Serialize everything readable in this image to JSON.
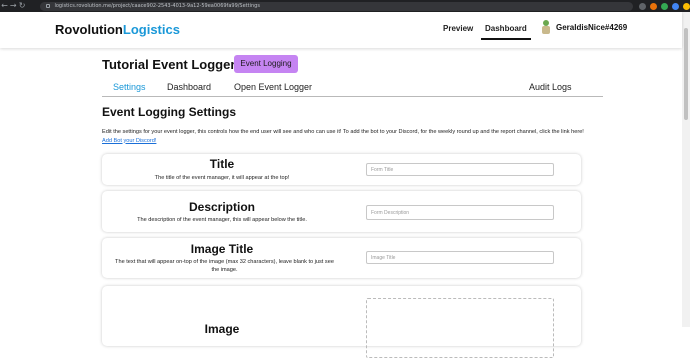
{
  "browser": {
    "url": "logistics.rovolution.me/project/caace902-2543-4013-9a12-59ea0069fa99/Settings"
  },
  "header": {
    "brand_main": "Rovolution",
    "brand_accent": "Logistics",
    "nav": {
      "preview": "Preview",
      "dashboard": "Dashboard"
    },
    "username": "GeraldisNice#4269"
  },
  "page": {
    "title": "Tutorial Event Logger",
    "tag": "Event Logging"
  },
  "tabs": {
    "settings": "Settings",
    "dashboard": "Dashboard",
    "open": "Open Event Logger",
    "audit": "Audit Logs"
  },
  "section": {
    "title": "Event Logging Settings",
    "intro": "Edit the settings for your event logger, this controls how the end user will see and who can use it! To add the bot to your Discord, for the weekly round up and the report channel, click the link here!",
    "link": "Add Bot your Discord!"
  },
  "fields": {
    "title": {
      "heading": "Title",
      "desc": "The title of the event manager, it will appear at the top!",
      "placeholder": "Form Title"
    },
    "description": {
      "heading": "Description",
      "desc": "The description of the event manager, this will appear below the title.",
      "placeholder": "Form Description"
    },
    "image_title": {
      "heading": "Image Title",
      "desc": "The text that will appear on-top of the image (max 32 characters), leave blank to just see the image.",
      "placeholder": "Image Title"
    },
    "image": {
      "heading": "Image"
    }
  },
  "colors": {
    "accent": "#1a98d8",
    "tag_bg": "#c584f2",
    "chrome_bg": "#202124"
  }
}
